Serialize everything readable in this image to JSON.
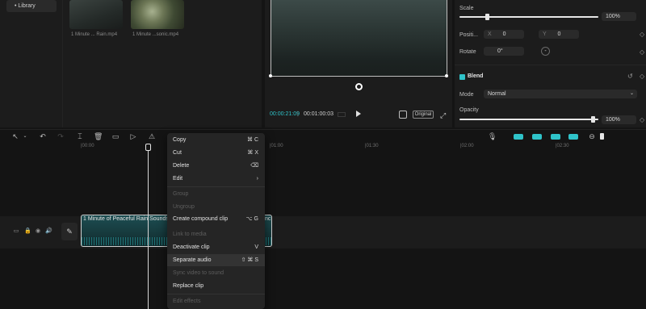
{
  "library": {
    "sidebar_item": "Library"
  },
  "media": [
    {
      "name": "1 Minute ... Rain.mp4"
    },
    {
      "name": "1 Minute ...sonic.mp4"
    }
  ],
  "player": {
    "current_time": "00:00:21:09",
    "total_time": "00:01:00:03",
    "original_label": "Original"
  },
  "properties": {
    "scale_label": "Scale",
    "scale_value": "100%",
    "scale_level": 1.0,
    "position_label": "Positi...",
    "pos_x_label": "X",
    "pos_x_value": "0",
    "pos_y_label": "Y",
    "pos_y_value": "0",
    "rotate_label": "Rotate",
    "rotate_value": "0°",
    "rotate_dash": "-",
    "blend_label": "Blend",
    "mode_label": "Mode",
    "mode_value": "Normal",
    "opacity_label": "Opacity",
    "opacity_value": "100%",
    "opacity_level": 1.0
  },
  "timeline": {
    "ruler": [
      "|00:00",
      "|01:00",
      "|01:30",
      "|02:00",
      "|02:30"
    ],
    "clip_title": "1 Minute of Peaceful Rain Sounds",
    "clip_tail": "nc"
  },
  "context_menu": {
    "items": [
      {
        "label": "Copy",
        "shortcut": "⌘  C",
        "disabled": false
      },
      {
        "label": "Cut",
        "shortcut": "⌘  X",
        "disabled": false
      },
      {
        "label": "Delete",
        "shortcut": "⌫",
        "disabled": false
      },
      {
        "label": "Edit",
        "shortcut": "›",
        "disabled": false
      },
      {
        "label": "Group",
        "shortcut": "",
        "disabled": true
      },
      {
        "label": "Ungroup",
        "shortcut": "",
        "disabled": true
      },
      {
        "label": "Create compound clip",
        "shortcut": "⌥  G",
        "disabled": false
      },
      {
        "label": "Link to media",
        "shortcut": "",
        "disabled": true
      },
      {
        "label": "Deactivate clip",
        "shortcut": "V",
        "disabled": false
      },
      {
        "label": "Separate audio",
        "shortcut": "⇧ ⌘  S",
        "disabled": false
      },
      {
        "label": "Sync video to sound",
        "shortcut": "",
        "disabled": true
      },
      {
        "label": "Replace clip",
        "shortcut": "",
        "disabled": false
      },
      {
        "label": "Edit effects",
        "shortcut": "",
        "disabled": true
      }
    ]
  },
  "colors": {
    "accent": "#2fc3c9",
    "panel": "#1c1c1c",
    "background": "#141414"
  }
}
